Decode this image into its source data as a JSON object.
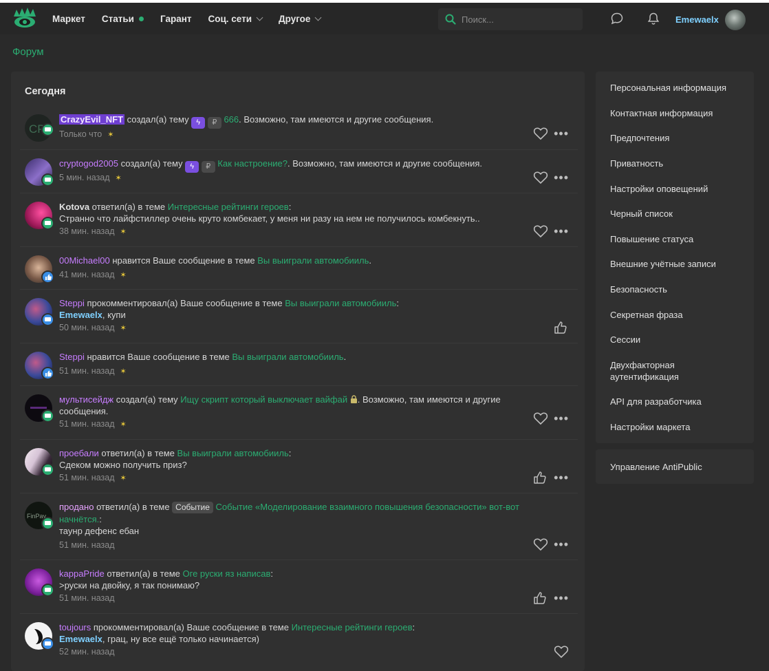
{
  "header": {
    "nav": [
      {
        "label": "Маркет"
      },
      {
        "label": "Статьи"
      },
      {
        "label": "Гарант"
      },
      {
        "label": "Соц. сети"
      },
      {
        "label": "Другое"
      }
    ],
    "search_placeholder": "Поиск...",
    "username": "Emewaelx"
  },
  "breadcrumb": "Форум",
  "section_title": "Сегодня",
  "alerts": [
    {
      "user": "CrazyEvil_NFT",
      "action": " создал(а) тему ",
      "topic": "666",
      "suffix": ". Возможно, там имеются и другие сообщения.",
      "time": "Только что"
    },
    {
      "user": "cryptogod2005",
      "action": " создал(а) тему ",
      "topic": "Как настроение?",
      "suffix": ". Возможно, там имеются и другие сообщения.",
      "time": "5 мин. назад"
    },
    {
      "user": "Kotova",
      "action": " ответил(а) в теме ",
      "topic": "Интересные рейтинги героев",
      "suffix": ":",
      "line2": "Странно что лайфстиллер очень круто комбекает, у меня ни разу на нем не получилось комбекнуть..",
      "time": "38 мин. назад"
    },
    {
      "user": "00Michael00",
      "action": " нравится Ваше сообщение в теме ",
      "topic": "Вы выиграли автомобииль",
      "suffix": ".",
      "time": "41 мин. назад"
    },
    {
      "user": "Steppi",
      "action": " прокомментировал(а) Ваше сообщение в теме ",
      "topic": "Вы выиграли автомобииль",
      "suffix": ":",
      "mention": "Emewaelx",
      "line2": ", купи",
      "time": "50 мин. назад"
    },
    {
      "user": "Steppi",
      "action": " нравится Ваше сообщение в теме ",
      "topic": "Вы выиграли автомобииль",
      "suffix": ".",
      "time": "51 мин. назад"
    },
    {
      "user": "мультисейдж",
      "action": " создал(а) тему ",
      "topic": "Ищу скрипт который выключает вайфай",
      "suffix": ". Возможно, там имеются и другие сообщения.",
      "time": "51 мин. назад"
    },
    {
      "user": "проебали",
      "action": " ответил(а) в теме ",
      "topic": "Вы выиграли автомобииль",
      "suffix": ":",
      "line2": "Сдеком можно получить приз?",
      "time": "51 мин. назад"
    },
    {
      "user": "продано",
      "action": " ответил(а) в теме ",
      "tag": "Событие",
      "topic": "Событие «Моделирование взаимного повышения безопасности» вот-вот начнётся.",
      "suffix": ":",
      "line2": "таунр дефенс ебан",
      "time": "51 мин. назад"
    },
    {
      "user": "kappaPride",
      "action": " ответил(а) в теме ",
      "topic": "Оге руски яз написав",
      "suffix": ":",
      "line2": ">руски на двойку, я так понимаю?",
      "time": "51 мин. назад"
    },
    {
      "user": "toujours",
      "action": " прокомментировал(а) Ваше сообщение в теме ",
      "topic": "Интересные рейтинги героев",
      "suffix": ":",
      "mention": "Emewaelx",
      "line2": ", грац, ну все ещё только начинается)",
      "time": "52 мин. назад"
    }
  ],
  "sidebar": {
    "items": [
      {
        "label": "Персональная информация"
      },
      {
        "label": "Контактная информация"
      },
      {
        "label": "Предпочтения"
      },
      {
        "label": "Приватность"
      },
      {
        "label": "Настройки оповещений"
      },
      {
        "label": "Черный список"
      },
      {
        "label": "Повышение статуса"
      },
      {
        "label": "Внешние учётные записи"
      },
      {
        "label": "Безопасность"
      },
      {
        "label": "Секретная фраза"
      },
      {
        "label": "Сессии"
      },
      {
        "label": "Двухфакторная аутентификация"
      },
      {
        "label": "API для разработчика"
      },
      {
        "label": "Настройки маркета"
      }
    ],
    "extra": "Управление AntiPublic"
  },
  "colors": {
    "accent": "#2bad72",
    "username": "#c77dff",
    "mention": "#7fd0ff"
  }
}
